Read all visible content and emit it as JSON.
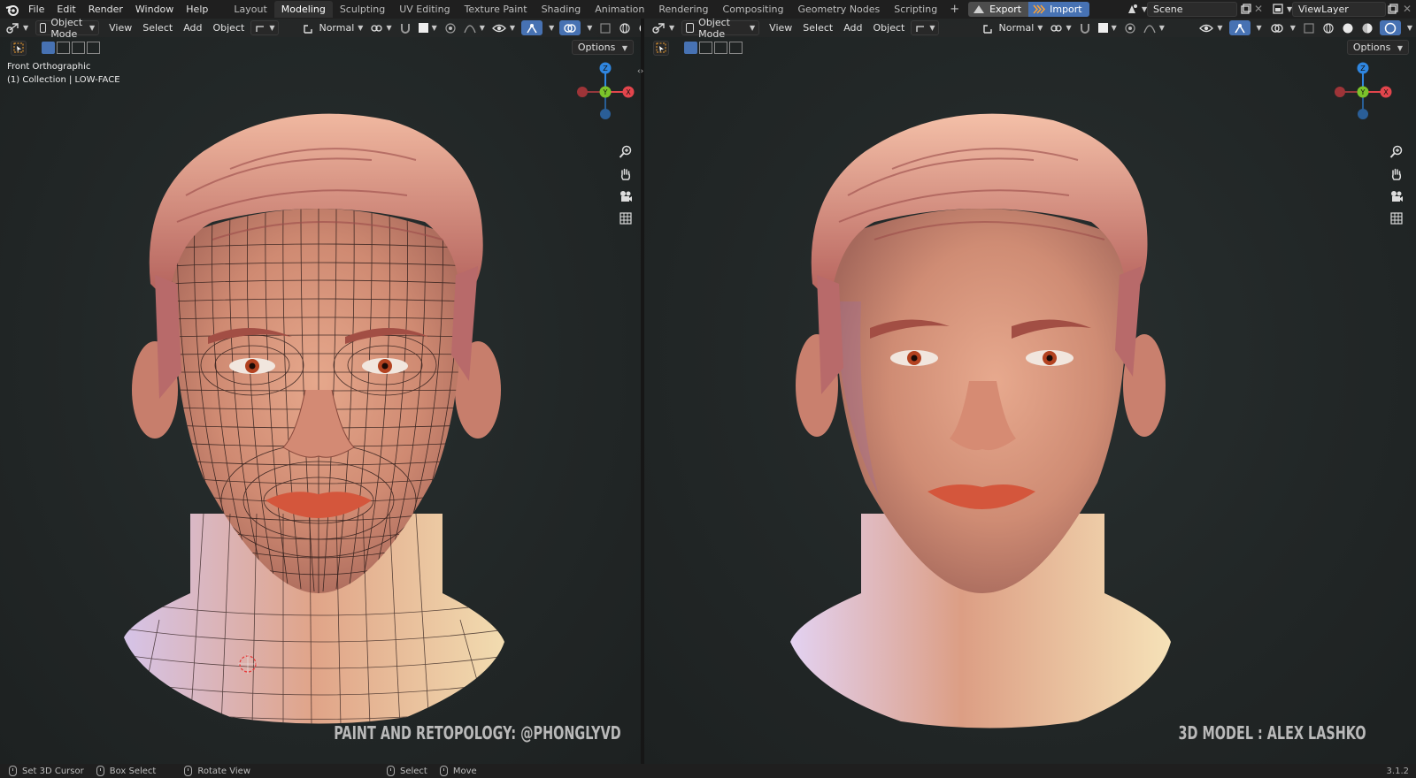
{
  "menu": [
    "File",
    "Edit",
    "Render",
    "Window",
    "Help"
  ],
  "workspaces": [
    {
      "label": "Layout",
      "active": false
    },
    {
      "label": "Modeling",
      "active": true
    },
    {
      "label": "Sculpting",
      "active": false
    },
    {
      "label": "UV Editing",
      "active": false
    },
    {
      "label": "Texture Paint",
      "active": false
    },
    {
      "label": "Shading",
      "active": false
    },
    {
      "label": "Animation",
      "active": false
    },
    {
      "label": "Rendering",
      "active": false
    },
    {
      "label": "Compositing",
      "active": false
    },
    {
      "label": "Geometry Nodes",
      "active": false
    },
    {
      "label": "Scripting",
      "active": false
    }
  ],
  "workspace_add": "+",
  "addons": {
    "export": "Export",
    "import": "Import"
  },
  "scene": "Scene",
  "view_layer": "ViewLayer",
  "viewport_header": {
    "mode": "Object Mode",
    "menus": [
      "View",
      "Select",
      "Add",
      "Object"
    ],
    "orientation": "Normal",
    "options": "Options"
  },
  "left_viewport": {
    "view_name": "Front Orthographic",
    "collection": "(1) Collection | LOW-FACE",
    "credit": "PAINT AND RETOPOLOGY: @PHONGLYVD"
  },
  "right_viewport": {
    "credit": "3D MODEL : ALEX LASHKO"
  },
  "gizmo": {
    "z": "Z",
    "y": "Y",
    "x": "X"
  },
  "status": [
    {
      "label": "Set 3D Cursor"
    },
    {
      "label": "Box Select"
    },
    {
      "label": "Rotate View"
    },
    {
      "label": "Select"
    },
    {
      "label": "Move"
    }
  ],
  "version": "3.1.2",
  "colors": {
    "accent": "#4772b3",
    "x_axis": "#e2454c",
    "y_axis": "#7bc42a",
    "z_axis": "#2f86e0"
  }
}
